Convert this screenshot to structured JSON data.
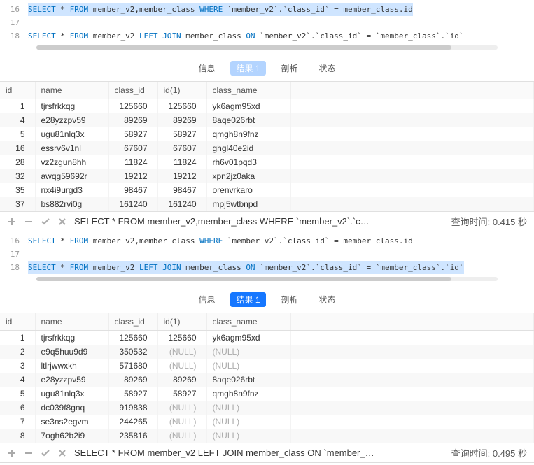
{
  "editor": {
    "lines": [
      {
        "num": "16",
        "tokens": [
          [
            "kw",
            "SELECT"
          ],
          [
            "op",
            " * "
          ],
          [
            "kw",
            "FROM"
          ],
          [
            "op",
            " member_v2,member_class "
          ],
          [
            "kw",
            "WHERE"
          ],
          [
            "op",
            " `member_v2`.`class_id` = member_class.id"
          ]
        ]
      },
      {
        "num": "17",
        "tokens": []
      },
      {
        "num": "18",
        "tokens": [
          [
            "kw",
            "SELECT"
          ],
          [
            "op",
            " * "
          ],
          [
            "kw",
            "FROM"
          ],
          [
            "op",
            " member_v2 "
          ],
          [
            "kw",
            "LEFT JOIN"
          ],
          [
            "op",
            " member_class "
          ],
          [
            "kw",
            "ON"
          ],
          [
            "op",
            " `member_v2`.`class_id` = `member_class`.`id`"
          ]
        ]
      }
    ]
  },
  "tabs": {
    "info": "信息",
    "result": "结果 1",
    "profile": "剖析",
    "status": "状态"
  },
  "columns": [
    "id",
    "name",
    "class_id",
    "id(1)",
    "class_name"
  ],
  "panel1": {
    "highlight_line": "16",
    "active_tab_style": "light",
    "rows": [
      {
        "id": "1",
        "name": "tjrsfrkkqg",
        "class_id": "125660",
        "id1": "125660",
        "class_name": "yk6agm95xd"
      },
      {
        "id": "4",
        "name": "e28yzzpv59",
        "class_id": "89269",
        "id1": "89269",
        "class_name": "8aqe026rbt"
      },
      {
        "id": "5",
        "name": "ugu81nlq3x",
        "class_id": "58927",
        "id1": "58927",
        "class_name": "qmgh8n9fnz"
      },
      {
        "id": "16",
        "name": "essrv6v1nl",
        "class_id": "67607",
        "id1": "67607",
        "class_name": "ghgl40e2id"
      },
      {
        "id": "28",
        "name": "vz2zgun8hh",
        "class_id": "11824",
        "id1": "11824",
        "class_name": "rh6v01pqd3"
      },
      {
        "id": "32",
        "name": "awqg59692r",
        "class_id": "19212",
        "id1": "19212",
        "class_name": "xpn2jz0aka"
      },
      {
        "id": "35",
        "name": "nx4i9urgd3",
        "class_id": "98467",
        "id1": "98467",
        "class_name": "orenvrkaro"
      },
      {
        "id": "37",
        "name": "bs882rvi0g",
        "class_id": "161240",
        "id1": "161240",
        "class_name": "mpj5wtbnpd"
      }
    ],
    "status_query": "SELECT * FROM member_v2,member_class WHERE `member_v2`.`c…",
    "status_time_label": "查询时间:",
    "status_time_value": "0.415 秒"
  },
  "panel2": {
    "highlight_line": "18",
    "active_tab_style": "blue",
    "rows": [
      {
        "id": "1",
        "name": "tjrsfrkkqg",
        "class_id": "125660",
        "id1": "125660",
        "class_name": "yk6agm95xd"
      },
      {
        "id": "2",
        "name": "e9q5huu9d9",
        "class_id": "350532",
        "id1": "(NULL)",
        "class_name": "(NULL)"
      },
      {
        "id": "3",
        "name": "ltlrjwwxkh",
        "class_id": "571680",
        "id1": "(NULL)",
        "class_name": "(NULL)"
      },
      {
        "id": "4",
        "name": "e28yzzpv59",
        "class_id": "89269",
        "id1": "89269",
        "class_name": "8aqe026rbt"
      },
      {
        "id": "5",
        "name": "ugu81nlq3x",
        "class_id": "58927",
        "id1": "58927",
        "class_name": "qmgh8n9fnz"
      },
      {
        "id": "6",
        "name": "dc039f8gnq",
        "class_id": "919838",
        "id1": "(NULL)",
        "class_name": "(NULL)"
      },
      {
        "id": "7",
        "name": "se3ns2egvm",
        "class_id": "244265",
        "id1": "(NULL)",
        "class_name": "(NULL)"
      },
      {
        "id": "8",
        "name": "7ogh62b2i9",
        "class_id": "235816",
        "id1": "(NULL)",
        "class_name": "(NULL)"
      }
    ],
    "status_query": "SELECT * FROM member_v2 LEFT JOIN member_class ON `member_…",
    "status_time_label": "查询时间:",
    "status_time_value": "0.495 秒"
  }
}
